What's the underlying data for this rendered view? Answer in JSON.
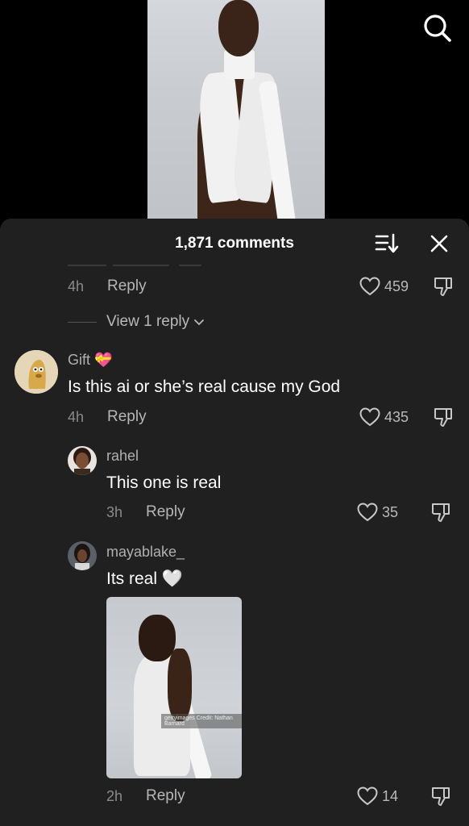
{
  "search": {
    "icon": "search-icon"
  },
  "sheet": {
    "title": "1,871 comments",
    "sort_icon": "sort-icon",
    "close_icon": "close-icon"
  },
  "prev_comment": {
    "time": "4h",
    "reply_label": "Reply",
    "likes": "459"
  },
  "view_replies": {
    "label": "View 1 reply"
  },
  "comments": [
    {
      "username": "Gift",
      "emoji": "💝",
      "text": "Is this ai or she’s real cause my God",
      "time": "4h",
      "reply_label": "Reply",
      "likes": "435"
    },
    {
      "username": "rahel",
      "text": "This one is real",
      "time": "3h",
      "reply_label": "Reply",
      "likes": "35"
    },
    {
      "username": "mayablake_",
      "text": "Its real 🤍",
      "time": "2h",
      "reply_label": "Reply",
      "likes": "14",
      "photo_watermark": "gettyimages Credit: Nathan Barnard"
    }
  ],
  "colors": {
    "background": "#000000",
    "sheet": "#202020",
    "muted": "#8a8a8a"
  }
}
